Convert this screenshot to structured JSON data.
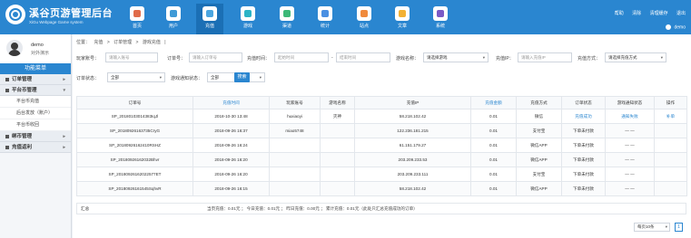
{
  "brand": {
    "title": "溪谷页游管理后台",
    "subtitle": "XiGu Webpage Game system"
  },
  "nav": [
    {
      "label": "首页",
      "icon": "home-icon",
      "color": "#e06c4b"
    },
    {
      "label": "用户",
      "icon": "user-icon",
      "color": "#3f9ad6"
    },
    {
      "label": "充值",
      "icon": "recharge-icon",
      "color": "#4aa5e0"
    },
    {
      "label": "游戏",
      "icon": "game-icon",
      "color": "#2bb3c6"
    },
    {
      "label": "渠道",
      "icon": "channel-icon",
      "color": "#3cb878"
    },
    {
      "label": "统计",
      "icon": "stats-icon",
      "color": "#4a90e2"
    },
    {
      "label": "站点",
      "icon": "site-icon",
      "color": "#f08a3c"
    },
    {
      "label": "文章",
      "icon": "article-icon",
      "color": "#f2b134"
    },
    {
      "label": "系统",
      "icon": "system-icon",
      "color": "#7a5ac6"
    }
  ],
  "top_right": {
    "help": "帮助",
    "clear": "清除",
    "cache": "清理缓存",
    "logout": "退出",
    "user": "demo"
  },
  "sidebar": {
    "name": "demo",
    "status": "对外演示",
    "menu_title": "功能菜单",
    "groups": [
      {
        "label": "订单管理",
        "items": []
      },
      {
        "label": "平台币管理",
        "items": [
          "平台币充值",
          "后台发放（账户）",
          "平台币收回"
        ]
      },
      {
        "label": "绑币管理",
        "items": []
      },
      {
        "label": "充值返利",
        "items": []
      }
    ]
  },
  "breadcrumb": [
    "位置：",
    "充值",
    ">",
    "订单管理",
    ">",
    "游戏充值",
    "|"
  ],
  "filters": {
    "player_label": "玩家账号：",
    "player_placeholder": "请输入账号",
    "order_label": "订单号：",
    "order_placeholder": "请输入订单号",
    "time_label": "充值时间：",
    "time_start_placeholder": "起始时间",
    "time_sep": "-",
    "time_end_placeholder": "结束时间",
    "game_label": "游戏名称：",
    "game_value": "请选择游戏",
    "ip_label": "充值IP：",
    "ip_placeholder": "请输入充值IP",
    "pay_label": "充值方式：",
    "pay_value": "请选择充值方式",
    "order_status_label": "订单状态：",
    "order_status_value": "全部",
    "notify_label": "游戏通知状态：",
    "notify_value": "全部",
    "search": "搜索"
  },
  "table": {
    "headers": [
      "订单号",
      "充值时间",
      "玩家账号",
      "游戏名称",
      "充值IP",
      "充值金额",
      "充值方式",
      "订单状态",
      "游戏通知状态",
      "操作"
    ],
    "sortable": [
      false,
      true,
      false,
      false,
      false,
      true,
      false,
      false,
      false,
      false
    ],
    "rows": [
      [
        "SP_20180103014383IqJl",
        "2018-10-30 13:48",
        "huxiaoyi",
        "灭神",
        "58.218.102.42",
        "0.01",
        "微信",
        "充值成功",
        "通知失败",
        "补单"
      ],
      [
        "SP_20180926163735CryG",
        "2018-09-26 16:37",
        "miao5748",
        "",
        "122.236.181.215",
        "0.01",
        "支付宝",
        "下单未付款",
        "— —",
        ""
      ],
      [
        "SP_20180926162410RSHZ",
        "2018-09-26 16:24",
        "",
        "",
        "61.151.179.27",
        "0.01",
        "微信APP",
        "下单未付款",
        "— —",
        ""
      ],
      [
        "SP_20180926162032Bhvr",
        "2018-09-26 16:20",
        "",
        "",
        "203.209.233.53",
        "0.01",
        "微信APP",
        "下单未付款",
        "— —",
        ""
      ],
      [
        "SP_20180926162022577ET",
        "2018-09-26 16:20",
        "",
        "",
        "203.209.233.111",
        "0.01",
        "支付宝",
        "下单未付款",
        "— —",
        ""
      ],
      [
        "SP_20180926161545SqhvR",
        "2018-09-26 16:15",
        "",
        "",
        "58.218.102.42",
        "0.01",
        "微信APP",
        "下单未付款",
        "— —",
        ""
      ]
    ],
    "link_cells": [
      [
        0,
        7
      ],
      [
        0,
        8
      ],
      [
        0,
        9
      ]
    ]
  },
  "summary": {
    "label": "汇总",
    "text": "当页充值：0.01元 ； 今日充值：0.01元 ； 昨日充值：0.00元 ； 累计充值：0.01元（此处只汇总充值成功的订单）"
  },
  "pager": {
    "per_page": "每页10条",
    "current": "1"
  }
}
